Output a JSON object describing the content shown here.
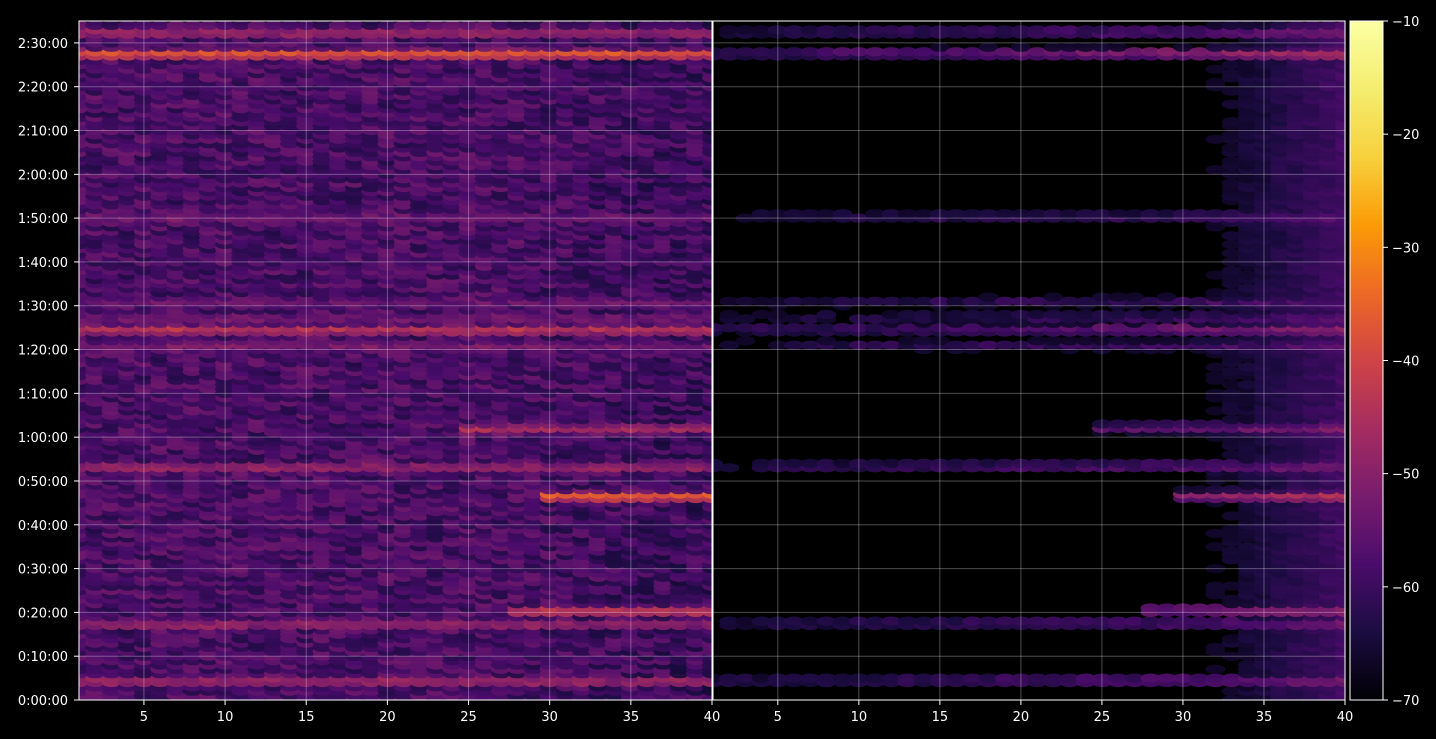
{
  "chart_data": {
    "type": "heatmap",
    "title": "",
    "xlabel": "",
    "ylabel": "",
    "panels": [
      {
        "name": "",
        "x_range": [
          1,
          40
        ],
        "x_ticks": [
          5,
          10,
          15,
          20,
          25,
          30,
          35
        ],
        "x_tick_labels": [
          "5",
          "10",
          "15",
          "20",
          "25",
          "30",
          "35"
        ],
        "right_edge_label": "40",
        "intensity_scale": 1.0
      },
      {
        "name": "",
        "x_range": [
          1,
          40
        ],
        "x_ticks": [
          5,
          10,
          15,
          20,
          25,
          30,
          35,
          40
        ],
        "x_tick_labels": [
          "5",
          "10",
          "15",
          "20",
          "25",
          "30",
          "35",
          "40"
        ],
        "intensity_scale": 0.55
      }
    ],
    "y_axis": {
      "unit": "seconds",
      "range": [
        0,
        9300
      ],
      "ticks": [
        0,
        600,
        1200,
        1800,
        2400,
        3000,
        3600,
        4200,
        4800,
        5400,
        6000,
        6600,
        7200,
        7800,
        8400,
        9000
      ],
      "tick_labels": [
        "0:00:00",
        "0:10:00",
        "0:20:00",
        "0:30:00",
        "0:40:00",
        "0:50:00",
        "1:00:00",
        "1:10:00",
        "1:20:00",
        "1:30:00",
        "1:40:00",
        "1:50:00",
        "2:00:00",
        "2:10:00",
        "2:20:00",
        "2:30:00"
      ]
    },
    "colorbar": {
      "colormap": "inferno",
      "range": [
        -70,
        -10
      ],
      "ticks": [
        -70,
        -60,
        -50,
        -40,
        -30,
        -20,
        -10
      ],
      "tick_labels": [
        "−70",
        "−60",
        "−50",
        "−40",
        "−30",
        "−20",
        "−10"
      ]
    },
    "grid": true,
    "background": "#000000",
    "hot_bands": [
      {
        "time": 270,
        "level": -44,
        "x_from": 1,
        "x_to": 40
      },
      {
        "time": 1050,
        "level": -46,
        "x_from": 1,
        "x_to": 40
      },
      {
        "time": 1230,
        "level": -38,
        "x_from": 28,
        "x_to": 40
      },
      {
        "time": 2800,
        "level": -30,
        "x_from": 30,
        "x_to": 40
      },
      {
        "time": 3200,
        "level": -45,
        "x_from": 1,
        "x_to": 40
      },
      {
        "time": 3730,
        "level": -44,
        "x_from": 25,
        "x_to": 40
      },
      {
        "time": 4860,
        "level": -52,
        "x_from": 1,
        "x_to": 40
      },
      {
        "time": 5080,
        "level": -40,
        "x_from": 1,
        "x_to": 40
      },
      {
        "time": 5240,
        "level": -52,
        "x_from": 1,
        "x_to": 40
      },
      {
        "time": 5460,
        "level": -54,
        "x_from": 1,
        "x_to": 40
      },
      {
        "time": 6620,
        "level": -52,
        "x_from": 1,
        "x_to": 40
      },
      {
        "time": 8860,
        "level": -32,
        "x_from": 1,
        "x_to": 40
      },
      {
        "time": 9150,
        "level": -45,
        "x_from": 1,
        "x_to": 40
      }
    ]
  }
}
